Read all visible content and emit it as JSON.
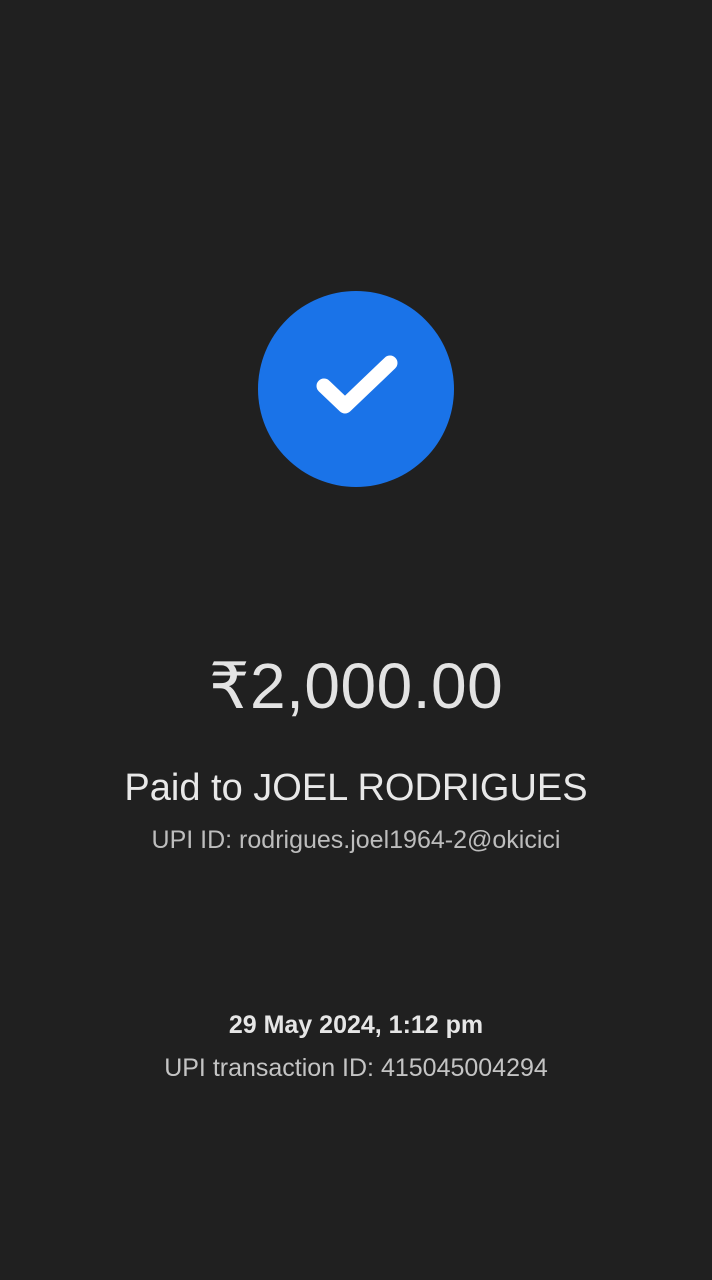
{
  "status": {
    "icon": "check-icon",
    "accent_color": "#1a73e8"
  },
  "payment": {
    "amount": "₹2,000.00",
    "paid_to": "Paid to JOEL RODRIGUES",
    "upi_id": "UPI ID: rodrigues.joel1964-2@okicici"
  },
  "details": {
    "datetime": "29 May 2024, 1:12 pm",
    "transaction_id": "UPI transaction ID: 415045004294"
  }
}
